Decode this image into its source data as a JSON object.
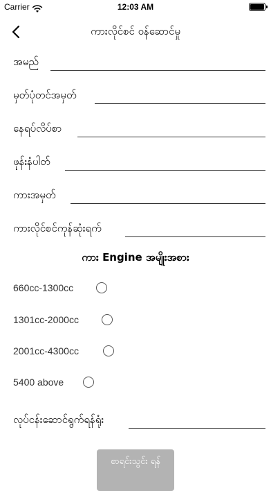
{
  "status_bar": {
    "carrier": "Carrier",
    "time": "12:03 AM"
  },
  "nav": {
    "title": "ကားလိုင်စင် ဝန်ဆောင်မှု"
  },
  "form": {
    "fields": [
      {
        "label": "အမည်",
        "value": ""
      },
      {
        "label": "မှတ်ပုံတင်အမှတ်",
        "value": ""
      },
      {
        "label": "နေရပ်လိပ်စာ",
        "value": ""
      },
      {
        "label": "ဖုန်းနံပါတ်",
        "value": ""
      },
      {
        "label": "ကားအမှတ်",
        "value": ""
      },
      {
        "label": "ကားလိုင်စင်ကုန်ဆုံးရက်",
        "value": ""
      }
    ],
    "engine_section_title": "ကား Engine အမျိုးအစား",
    "engine_options": [
      {
        "label": "660cc-1300cc",
        "selected": false
      },
      {
        "label": "1301cc-2000cc",
        "selected": false
      },
      {
        "label": "2001cc-4300cc",
        "selected": false
      },
      {
        "label": "5400 above",
        "selected": false
      }
    ],
    "pickup_label": "လုပ်ငန်းဆောင်ရွက်ရန်ရုံး",
    "pickup_value": "",
    "submit_label": "စာရင်းသွင်း ရန်"
  }
}
